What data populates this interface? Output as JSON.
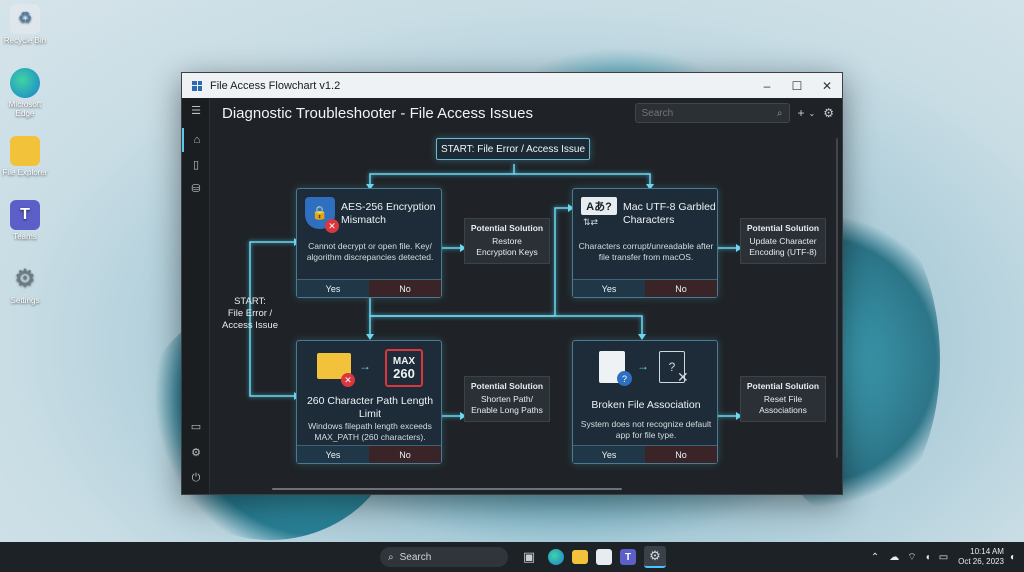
{
  "desktop": {
    "icons": [
      {
        "label": "Recycle Bin",
        "icon": "recycle-bin-icon"
      },
      {
        "label": "Microsoft Edge",
        "icon": "edge-icon"
      },
      {
        "label": "File Explorer",
        "icon": "folder-icon"
      },
      {
        "label": "Teams",
        "icon": "teams-icon"
      },
      {
        "label": "Settings",
        "icon": "gear-icon"
      }
    ]
  },
  "window": {
    "title": "File Access Flowchart v1.2",
    "controls": {
      "minimize": "–",
      "maximize": "☐",
      "close": "✕"
    }
  },
  "header": {
    "page_title": "Diagnostic Troubleshooter - File Access Issues",
    "search_placeholder": "Search"
  },
  "flow": {
    "start_label": "START: File Error / Access Issue",
    "side_start": {
      "line1": "START:",
      "line2": "File Error /",
      "line3": "Access Issue"
    },
    "nodes": [
      {
        "title": "AES-256 Encryption Mismatch",
        "desc": "Cannot decrypt or open file. Key/ algorithm discrepancies detected.",
        "yes": "Yes",
        "no": "No"
      },
      {
        "title": "Mac UTF-8 Garbled Characters",
        "icon_text": "Aあ?",
        "desc": "Characters corrupt/unreadable after file transfer from macOS.",
        "yes": "Yes",
        "no": "No"
      },
      {
        "title": "260 Character Path Length Limit",
        "badge_top": "MAX",
        "badge_bottom": "260",
        "desc": "Windows filepath length exceeds MAX_PATH (260 characters).",
        "yes": "Yes",
        "no": "No"
      },
      {
        "title": "Broken File Association",
        "desc": "System does not recognize default app for file type.",
        "yes": "Yes",
        "no": "No"
      }
    ],
    "solutions": [
      {
        "head": "Potential Solution",
        "text1": "Restore",
        "text2": "Encryption Keys"
      },
      {
        "head": "Potential Solution",
        "text1": "Update Character",
        "text2": "Encoding (UTF-8)"
      },
      {
        "head": "Potential Solution",
        "text1": "Shorten Path/",
        "text2": "Enable Long Paths"
      },
      {
        "head": "Potential Solution",
        "text1": "Reset File",
        "text2": "Associations"
      }
    ]
  },
  "taskbar": {
    "search_label": "Search",
    "time": "10:14 AM",
    "date": "Oct 26, 2023"
  },
  "colors": {
    "accent": "#5cc8e6",
    "node_bg": "#1d2c38",
    "no_bg": "#3a2428"
  }
}
